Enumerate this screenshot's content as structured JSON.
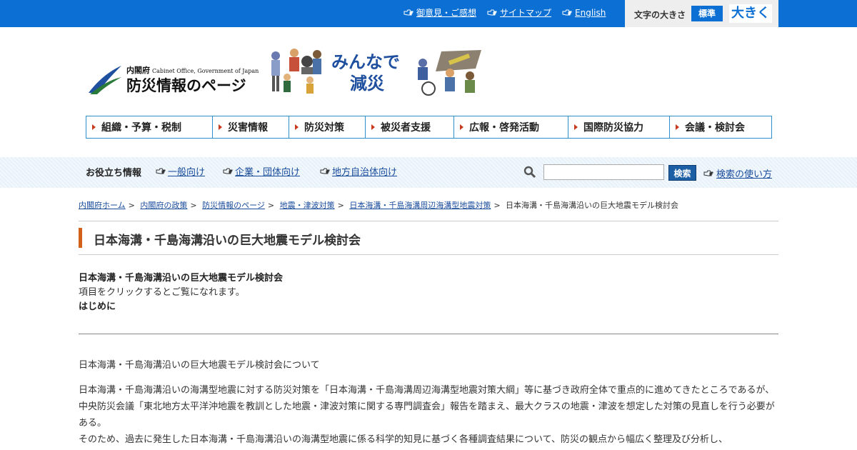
{
  "top": {
    "links": [
      {
        "label": "御意見・ご感想",
        "icon": "pointing-hand-icon"
      },
      {
        "label": "サイトマップ",
        "icon": "pointing-hand-icon"
      },
      {
        "label": "English",
        "icon": "pointing-hand-icon"
      }
    ],
    "fontsize_label": "文字の大きさ",
    "fontsize_standard": "標準",
    "fontsize_large": "大きく"
  },
  "logo": {
    "org": "内閣府",
    "org_en": "Cabinet Office, Government of Japan",
    "title": "防災情報のページ"
  },
  "banner": {
    "line1": "みんなで",
    "line2": "減災"
  },
  "nav": [
    {
      "label": "組織・予算・税制"
    },
    {
      "label": "災害情報"
    },
    {
      "label": "防災対策"
    },
    {
      "label": "被災者支援"
    },
    {
      "label": "広報・啓発活動"
    },
    {
      "label": "国際防災協力"
    },
    {
      "label": "会議・検討会"
    }
  ],
  "helpful": {
    "title": "お役立ち情報",
    "links": [
      {
        "label": "一般向け"
      },
      {
        "label": "企業・団体向け"
      },
      {
        "label": "地方自治体向け"
      }
    ],
    "search_button": "検索",
    "search_help": "検索の使い方"
  },
  "breadcrumb": [
    {
      "label": "内閣府ホーム",
      "link": true
    },
    {
      "label": "内閣府の政策",
      "link": true
    },
    {
      "label": "防災情報のページ",
      "link": true
    },
    {
      "label": "地震・津波対策",
      "link": true
    },
    {
      "label": "日本海溝・千島海溝周辺海溝型地震対策",
      "link": true
    },
    {
      "label": "日本海溝・千島海溝沿いの巨大地震モデル検討会",
      "link": false
    }
  ],
  "page_title": "日本海溝・千島海溝沿いの巨大地震モデル検討会",
  "content": {
    "subtitle": "日本海溝・千島海溝沿いの巨大地震モデル検討会",
    "instruction": "項目をクリックするとご覧になれます。",
    "intro": "はじめに",
    "about": "日本海溝・千島海溝沿いの巨大地震モデル検討会について",
    "paragraph1": "日本海溝・千島海溝沿いの海溝型地震に対する防災対策を「日本海溝・千島海溝周辺海溝型地震対策大綱」等に基づき政府全体で重点的に進めてきたところであるが、中央防災会議「東北地方太平洋沖地震を教訓とした地震・津波対策に関する専門調査会」報告を踏まえ、最大クラスの地震・津波を想定した対策の見直しを行う必要がある。",
    "paragraph2": "そのため、過去に発生した日本海溝・千島海溝沿いの海溝型地震に係る科学的知見に基づく各種調査結果について、防災の観点から幅広く整理及び分析し、"
  },
  "colors": {
    "topbar": "#0b6fd3",
    "accent": "#d2611a",
    "nav_border": "#2f8fc9",
    "link": "#1a4c9c"
  }
}
